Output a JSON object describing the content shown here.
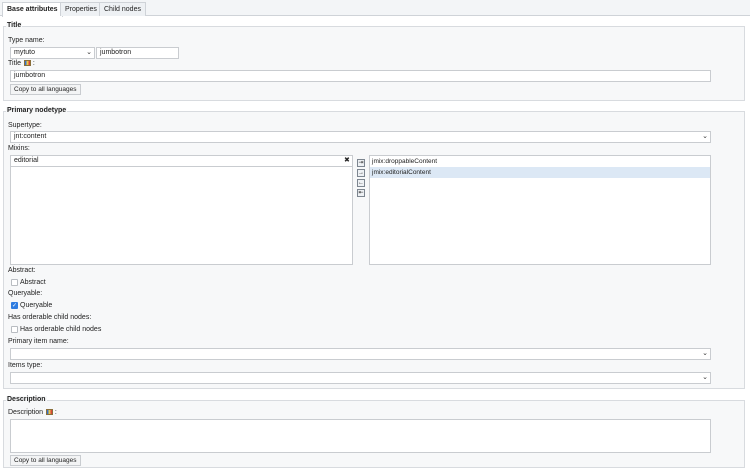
{
  "tabs": [
    "Base attributes",
    "Properties",
    "Child nodes"
  ],
  "title_section": {
    "legend": "Title",
    "type_name_label": "Type name:",
    "prefix_value": "mytuto",
    "name_value": "jumbotron",
    "title_label": "Title",
    "title_suffix": ":",
    "title_value": "jumbotron",
    "copy_button": "Copy to all languages"
  },
  "primary": {
    "legend": "Primary nodetype",
    "supertype_label": "Supertype:",
    "supertype_value": "jnt:content",
    "mixins_label": "Mixins:",
    "mixin_filter_value": "editorial",
    "clear_glyph": "✖",
    "available_mixins": [],
    "selected_mixins": [
      "jmix:droppableContent",
      "jmix:editorialContent"
    ],
    "move_buttons": [
      "⇥",
      "→",
      "←",
      "⇤"
    ],
    "abstract_label": "Abstract:",
    "abstract_checkbox": "Abstract",
    "abstract_checked": false,
    "queryable_label": "Queryable:",
    "queryable_checkbox": "Queryable",
    "queryable_checked": true,
    "orderable_label": "Has orderable child nodes:",
    "orderable_checkbox": "Has orderable child nodes",
    "orderable_checked": false,
    "primary_item_label": "Primary item name:",
    "primary_item_value": "",
    "items_type_label": "Items type:",
    "items_type_value": ""
  },
  "description_section": {
    "legend": "Description",
    "label": "Description",
    "suffix": ":",
    "value": "",
    "copy_button": "Copy to all languages"
  },
  "icons": {
    "flag": "language-flag-icon",
    "dropdown": "chevron-down-icon",
    "clear": "clear-icon"
  },
  "colors": {
    "accent": "#2f7de1",
    "selected_row": "#dce8f5"
  }
}
